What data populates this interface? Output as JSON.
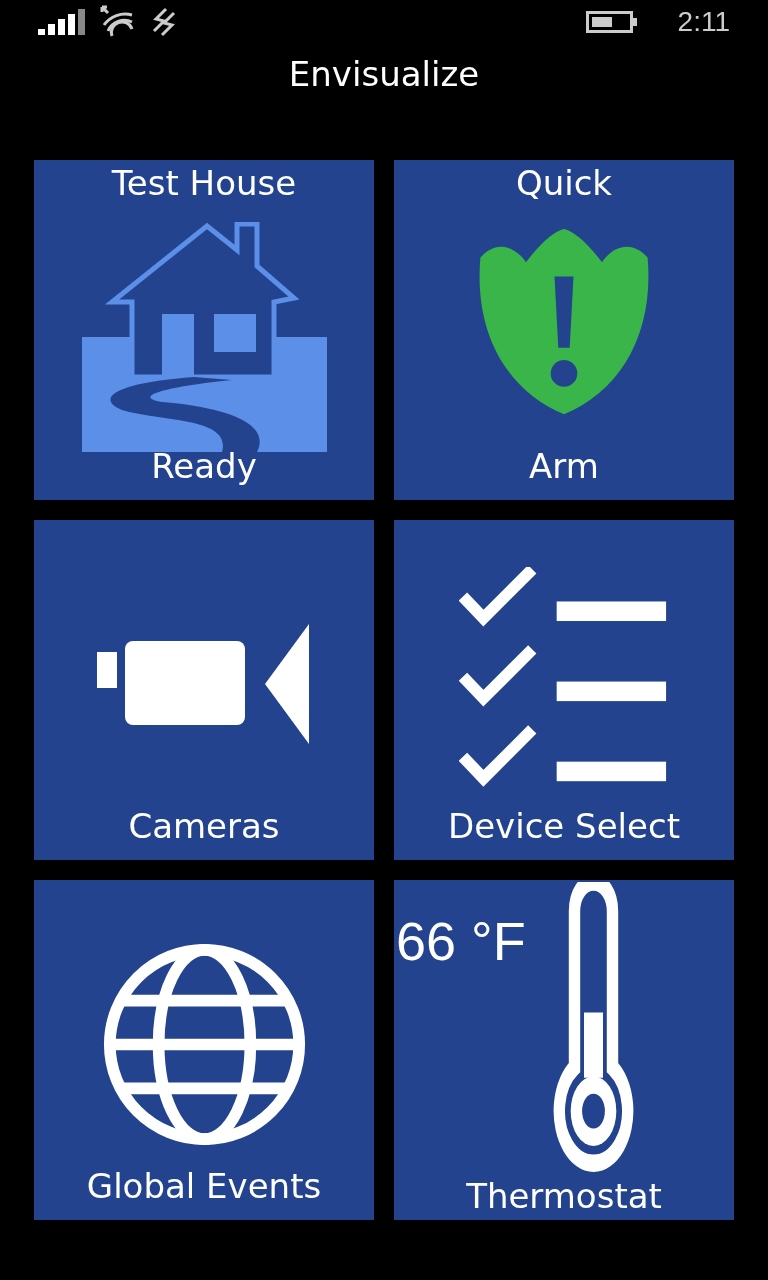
{
  "status_bar": {
    "time": "2:11"
  },
  "title": "Envisualize",
  "tiles": [
    {
      "kind": "house",
      "top_label": "Test House",
      "bottom_label": "Ready"
    },
    {
      "kind": "shield",
      "top_label": "Quick",
      "bottom_label": "Arm"
    },
    {
      "kind": "camera",
      "bottom_label": "Cameras"
    },
    {
      "kind": "checklist",
      "bottom_label": "Device Select"
    },
    {
      "kind": "globe",
      "bottom_label": "Global Events"
    },
    {
      "kind": "thermometer",
      "reading": "66 °F",
      "bottom_label": "Thermostat"
    }
  ]
}
